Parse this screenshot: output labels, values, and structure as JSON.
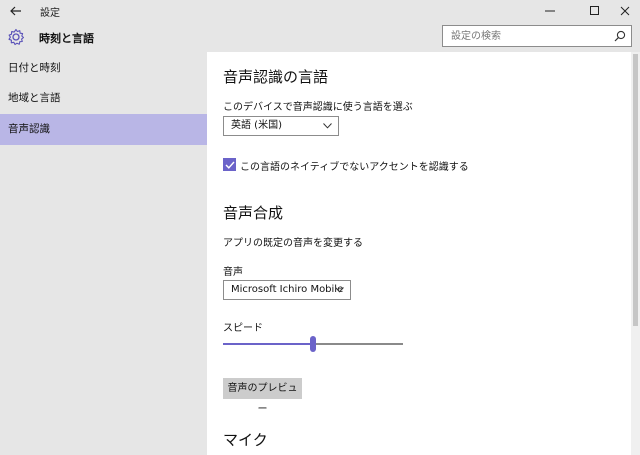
{
  "window": {
    "title": "設定",
    "back_icon": "arrow-left-icon",
    "minimize_icon": "minimize-icon",
    "maximize_icon": "maximize-icon",
    "close_icon": "close-icon"
  },
  "header": {
    "icon": "gear-icon",
    "title": "時刻と言語",
    "search_placeholder": "設定の検索",
    "search_icon": "search-icon"
  },
  "sidebar": {
    "items": [
      {
        "label": "日付と時刻",
        "active": false
      },
      {
        "label": "地域と言語",
        "active": false
      },
      {
        "label": "音声認識",
        "active": true
      }
    ]
  },
  "speech_language": {
    "heading": "音声認識の言語",
    "label": "このデバイスで音声認識に使う言語を選ぶ",
    "selected": "英語 (米国)",
    "checkbox_checked": true,
    "checkbox_label": "この言語のネイティブでないアクセントを認識する"
  },
  "tts": {
    "heading": "音声合成",
    "description": "アプリの既定の音声を変更する",
    "voice_label": "音声",
    "voice_selected": "Microsoft Ichiro Mobile",
    "speed_label": "スピード",
    "speed_value_fraction": 0.5,
    "preview_button": "音声のプレビュー"
  },
  "microphone": {
    "heading": "マイク"
  },
  "colors": {
    "accent": "#6b63c9",
    "nav_active": "#b9b6e6",
    "chrome": "#e6e6e6"
  }
}
